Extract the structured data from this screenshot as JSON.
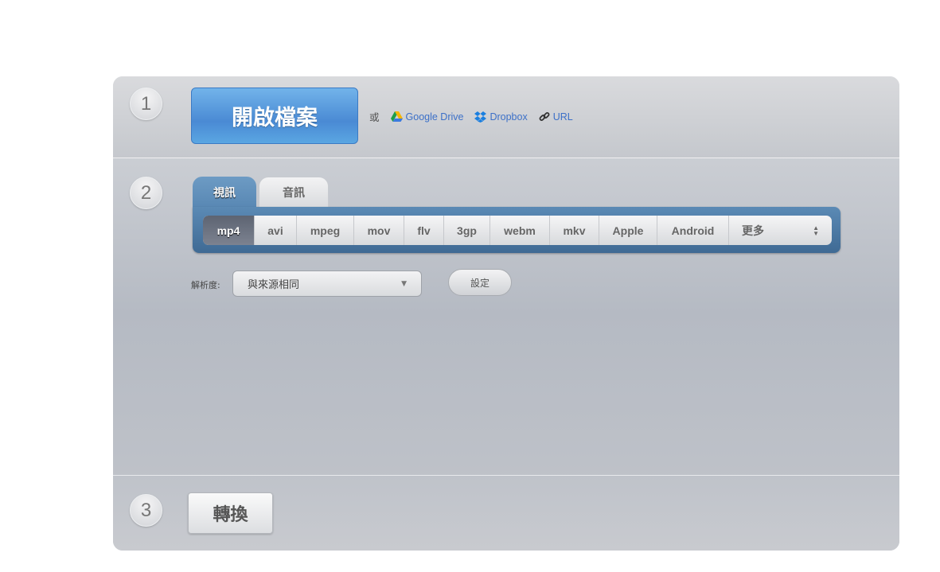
{
  "steps": {
    "one": "1",
    "two": "2",
    "three": "3"
  },
  "open_file": {
    "label": "開啟檔案"
  },
  "sources": {
    "or": "或",
    "google_drive": "Google Drive",
    "dropbox": "Dropbox",
    "url": "URL"
  },
  "tabs": [
    {
      "label": "視訊",
      "active": true
    },
    {
      "label": "音訊",
      "active": false
    }
  ],
  "formats": [
    "mp4",
    "avi",
    "mpeg",
    "mov",
    "flv",
    "3gp",
    "webm",
    "mkv",
    "Apple",
    "Android"
  ],
  "selected_format": "mp4",
  "more_label": "更多",
  "resolution": {
    "label": "解析度:",
    "value": "與來源相同"
  },
  "settings_label": "設定",
  "convert_label": "轉換",
  "colors": {
    "accent_blue": "#4a8ad4",
    "link": "#3c70c8",
    "tab_bar": "#4f7ca6"
  }
}
